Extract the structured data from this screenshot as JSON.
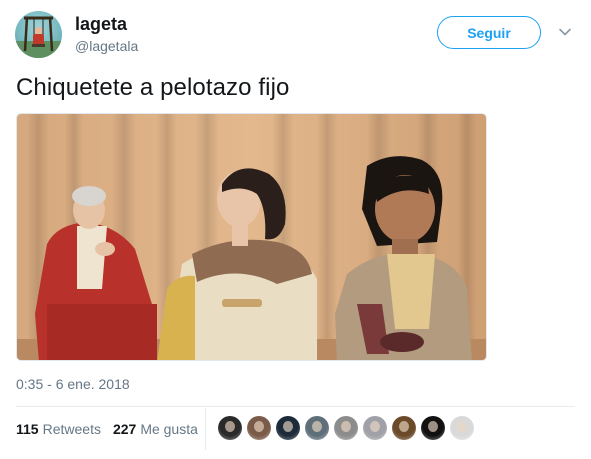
{
  "user": {
    "display_name": "lageta",
    "handle": "@lagetala"
  },
  "follow_label": "Seguir",
  "tweet_text": "Chiquetete a pelotazo fijo",
  "timestamp": "0:35 - 6 ene. 2018",
  "stats": {
    "retweets_count": "115",
    "retweets_label": "Retweets",
    "likes_count": "227",
    "likes_label": "Me gusta"
  },
  "likers": [
    {
      "icon": "liker-avatar-1",
      "color": "#2a2a2a"
    },
    {
      "icon": "liker-avatar-2",
      "color": "#7a5a48"
    },
    {
      "icon": "liker-avatar-3",
      "color": "#1d2a3a"
    },
    {
      "icon": "liker-avatar-4",
      "color": "#5f6f7a"
    },
    {
      "icon": "liker-avatar-5",
      "color": "#8c8c8c"
    },
    {
      "icon": "liker-avatar-6",
      "color": "#a0a0a8"
    },
    {
      "icon": "liker-avatar-7",
      "color": "#6b4a2a"
    },
    {
      "icon": "liker-avatar-8",
      "color": "#111111"
    },
    {
      "icon": "liker-avatar-9",
      "color": "#d9d9d9"
    }
  ],
  "colors": {
    "accent": "#1da1f2",
    "secondary_text": "#657786",
    "primary_text": "#14171a"
  }
}
